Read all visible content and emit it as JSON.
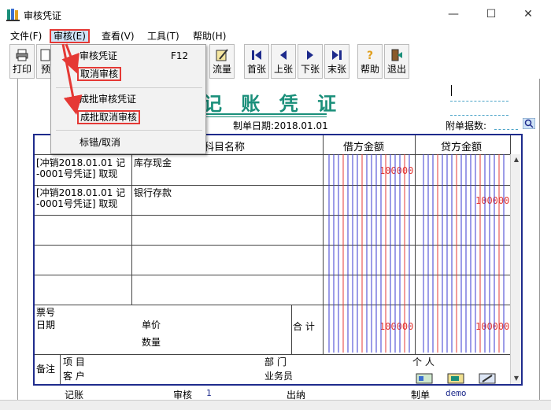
{
  "window": {
    "title": "审核凭证",
    "minimize": "—",
    "maximize": "☐",
    "close": "✕"
  },
  "menubar": {
    "items": [
      {
        "label": "文件(F)"
      },
      {
        "label": "审核(E)"
      },
      {
        "label": "查看(V)"
      },
      {
        "label": "工具(T)"
      },
      {
        "label": "帮助(H)"
      }
    ]
  },
  "toolbar": {
    "buttons": [
      {
        "label": "打印",
        "icon": "printer-icon"
      },
      {
        "label": "预",
        "icon": "preview-icon"
      },
      {
        "label": "流量",
        "icon": "edit-icon"
      },
      {
        "label": "首张",
        "icon": "first-icon"
      },
      {
        "label": "上张",
        "icon": "prev-icon"
      },
      {
        "label": "下张",
        "icon": "next-icon"
      },
      {
        "label": "末张",
        "icon": "last-icon"
      },
      {
        "label": "帮助",
        "icon": "help-icon"
      },
      {
        "label": "退出",
        "icon": "exit-icon"
      }
    ]
  },
  "dropdown": {
    "items": [
      {
        "label": "审核凭证",
        "shortcut": "F12"
      },
      {
        "label": "取消审核"
      },
      {
        "label": "成批审核凭证"
      },
      {
        "label": "成批取消审核"
      },
      {
        "label": "标错/取消"
      }
    ]
  },
  "voucher": {
    "title": "记 账 凭 证",
    "date_label": "制单日期:2018.01.01",
    "attach_label": "附单据数:",
    "columns": {
      "account": "科目名称",
      "debit": "借方金额",
      "credit": "贷方金额"
    },
    "rows": [
      {
        "summary_line1": "[冲销2018.01.01 记",
        "summary_line2": "-0001号凭证] 取现",
        "account": "库存现金",
        "debit": "100000",
        "credit": ""
      },
      {
        "summary_line1": "[冲销2018.01.01 记",
        "summary_line2": "-0001号凭证] 取现",
        "account": "银行存款",
        "debit": "",
        "credit": "100000"
      }
    ],
    "ticket_label": "票号",
    "date_row_label": "日期",
    "price_label": "单价",
    "qty_label": "数量",
    "total_label": "合 计",
    "total_debit": "100000",
    "total_credit": "100000",
    "remark_label": "备注",
    "project_label": "项  目",
    "customer_label": "客  户",
    "dept_label": "部  门",
    "salesman_label": "业务员",
    "person_label": "个  人"
  },
  "footer": {
    "bookkeeping_label": "记账",
    "audit_label": "审核",
    "audit_value": "1",
    "cashier_label": "出纳",
    "maker_label": "制单",
    "maker_value": "demo"
  },
  "colors": {
    "title_teal": "#1a8f7a",
    "grid_blue": "#1e2b8c",
    "amount_red": "#e53935",
    "highlight_red": "#e53935"
  }
}
